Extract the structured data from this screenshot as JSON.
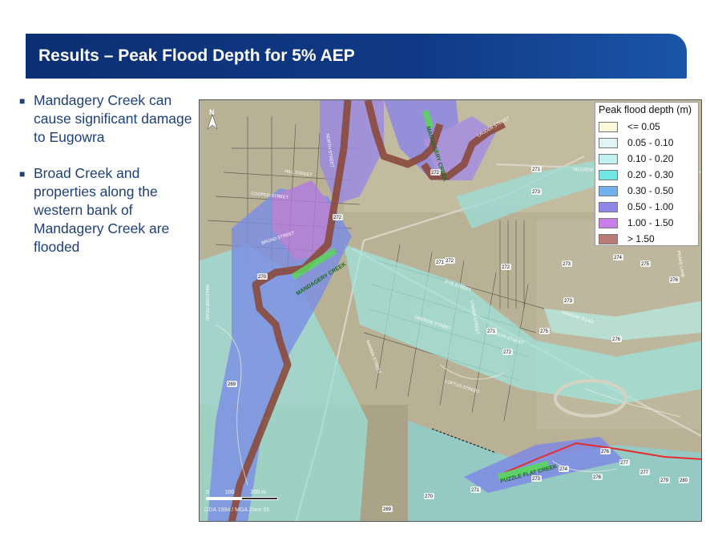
{
  "slide": {
    "title": "Results – Peak Flood Depth for 5% AEP"
  },
  "bullets": [
    {
      "text": "Mandagery Creek can cause significant damage to Eugowra"
    },
    {
      "text": "Broad Creek and properties along the western bank of Mandagery Creek are flooded"
    }
  ],
  "map": {
    "legend": {
      "title": "Peak flood depth (m)",
      "items": [
        {
          "label": "<= 0.05",
          "color": "#fbf8dc"
        },
        {
          "label": "0.05 - 0.10",
          "color": "#dff5f5"
        },
        {
          "label": "0.10 - 0.20",
          "color": "#c2f0ee"
        },
        {
          "label": "0.20 - 0.30",
          "color": "#6fe6e6"
        },
        {
          "label": "0.30 - 0.50",
          "color": "#6fb2ee"
        },
        {
          "label": "0.50 - 1.00",
          "color": "#8e86e8"
        },
        {
          "label": "1.00 - 1.50",
          "color": "#c77ee8"
        },
        {
          "label": "> 1.50",
          "color": "#b97a78"
        }
      ]
    },
    "north_label": "N",
    "scale_labels": [
      "0",
      "100",
      "200 m"
    ],
    "projection": "GDA 1994 / MGA Zone 55",
    "streets": [
      "HILL STREET",
      "COOPER STREET",
      "NORTH STREET",
      "BROAD STREET",
      "PYE STREET",
      "OBERON STREET",
      "NANIMA STREET",
      "EVELYN STREET",
      "LOFTUS STREET",
      "HILLVIEW ROAD",
      "NANGAR ROAD",
      "WALFORD ROAD",
      "LAUDER STREET",
      "LOWER STREET",
      "PEAKE LANE"
    ],
    "creeks": [
      "MANDAGERY CREEK",
      "MANDAGERY CREEK",
      "PUZZLE FLAT CREEK"
    ],
    "contours": [
      "272",
      "271",
      "272",
      "273",
      "272",
      "271",
      "272",
      "270",
      "271",
      "273",
      "274",
      "275",
      "276",
      "273",
      "269",
      "272",
      "273",
      "274",
      "276",
      "277",
      "276",
      "277",
      "279",
      "280",
      "275",
      "276",
      "271",
      "270",
      "269"
    ]
  }
}
